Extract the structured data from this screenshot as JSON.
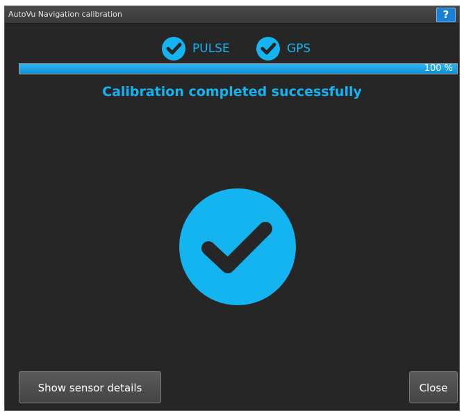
{
  "window": {
    "title": "AutoVu Navigation calibration",
    "help_label": "?"
  },
  "sensors": [
    {
      "label": "PULSE",
      "status": "ok",
      "icon": "check-circle-icon"
    },
    {
      "label": "GPS",
      "status": "ok",
      "icon": "check-circle-icon"
    }
  ],
  "progress": {
    "value": 100,
    "text": "100 %"
  },
  "status_message": "Calibration completed successfully",
  "center_icon": "large-check-circle-icon",
  "buttons": {
    "details_label": "Show sensor details",
    "close_label": "Close"
  },
  "colors": {
    "accent": "#14b4f0",
    "background": "#262626",
    "help_button": "#1a7fd6"
  }
}
